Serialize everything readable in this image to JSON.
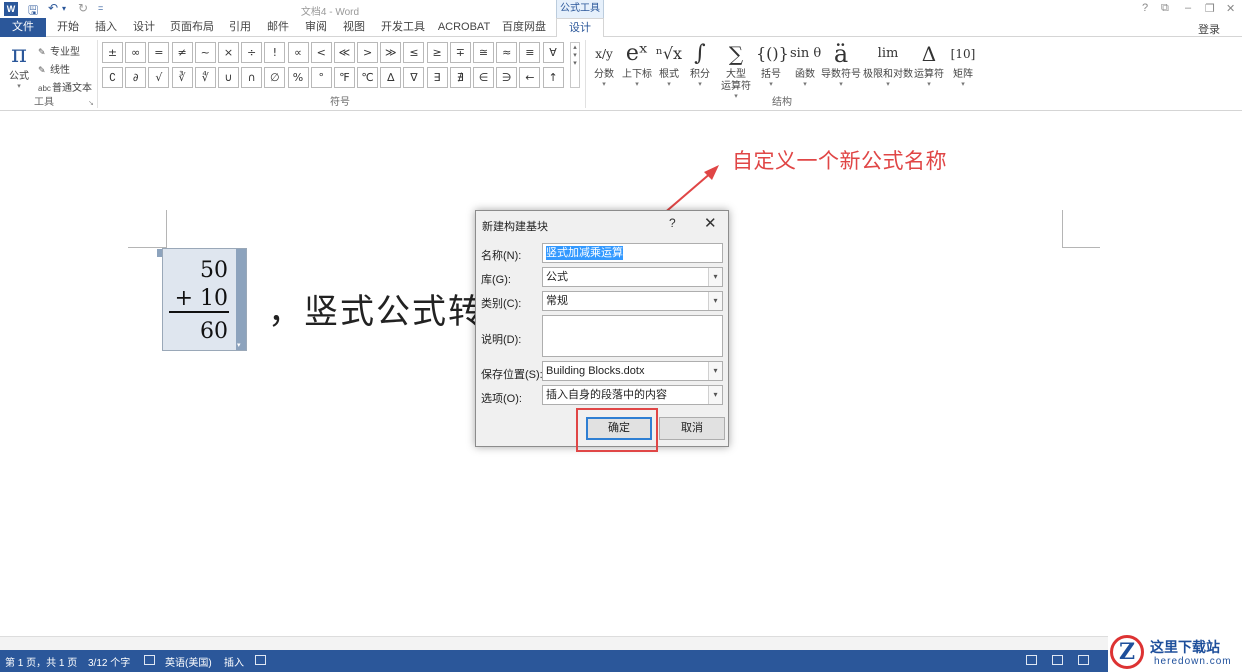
{
  "window": {
    "title": "文档4 - Word",
    "context_tab_group": "公式工具",
    "login": "登录",
    "controls": [
      "?",
      "⧉",
      "–",
      "❐",
      "✕"
    ]
  },
  "tabs": [
    "文件",
    "开始",
    "插入",
    "设计",
    "页面布局",
    "引用",
    "邮件",
    "审阅",
    "视图",
    "开发工具",
    "ACROBAT",
    "百度网盘",
    "设计"
  ],
  "tools_group": {
    "equation_label": "公式",
    "professional": "专业型",
    "linear": "线性",
    "normal_text": "普通文本",
    "group_label": "工具"
  },
  "symbols_group": {
    "row1": [
      "±",
      "∞",
      "=",
      "≠",
      "~",
      "×",
      "÷",
      "!",
      "∝",
      "<",
      "≪",
      ">",
      "≫",
      "≤",
      "≥",
      "∓",
      "≅",
      "≈",
      "≡",
      "∀"
    ],
    "row2": [
      "∁",
      "∂",
      "√",
      "∛",
      "∜",
      "∪",
      "∩",
      "∅",
      "%",
      "°",
      "℉",
      "℃",
      "∆",
      "∇",
      "∃",
      "∄",
      "∈",
      "∋",
      "←",
      "↑"
    ],
    "group_label": "符号"
  },
  "structures_group": {
    "items": [
      {
        "glyph": "x/y",
        "label": "分数"
      },
      {
        "glyph": "eˣ",
        "label": "上下标"
      },
      {
        "glyph": "ⁿ√x",
        "label": "根式"
      },
      {
        "glyph": "∫",
        "label": "积分"
      },
      {
        "glyph": "∑",
        "label": "大型",
        "label2": "运算符"
      },
      {
        "glyph": "{()}",
        "label": "括号"
      },
      {
        "glyph": "sin θ",
        "label": "函数"
      },
      {
        "glyph": "ä",
        "label": "导数符号"
      },
      {
        "glyph": "lim",
        "label": "极限和对数"
      },
      {
        "glyph": "Δ",
        "label": "运算符"
      },
      {
        "glyph": "[10]",
        "label": "矩阵"
      }
    ],
    "group_label": "结构"
  },
  "document": {
    "equation_lines": [
      "50",
      "+ 10",
      "60"
    ],
    "body_text": "，竖式公式转"
  },
  "annotation": {
    "text": "自定义一个新公式名称",
    "color": "#e04646"
  },
  "dialog": {
    "title": "新建构建基块",
    "help": "?",
    "close": "✕",
    "fields": [
      {
        "label": "名称(N):",
        "value": "竖式加减乘运算",
        "selected": true
      },
      {
        "label": "库(G):",
        "value": "公式",
        "dropdown": true
      },
      {
        "label": "类别(C):",
        "value": "常规",
        "dropdown": true
      },
      {
        "label": "说明(D):",
        "value": ""
      },
      {
        "label": "保存位置(S):",
        "value": "Building Blocks.dotx",
        "dropdown": true
      },
      {
        "label": "选项(O):",
        "value": "插入自身的段落中的内容",
        "dropdown": true
      }
    ],
    "ok": "确定",
    "cancel": "取消"
  },
  "statusbar": {
    "page": "第 1 页，共 1 页",
    "words": "3/12 个字",
    "language": "英语(美国)",
    "mode": "插入"
  },
  "watermark": {
    "title": "这里下载站",
    "site": "heredown.com"
  },
  "colors": {
    "word_blue": "#2b579a",
    "annotation_red": "#e04646",
    "dialog_bg": "#f0f0f0"
  }
}
